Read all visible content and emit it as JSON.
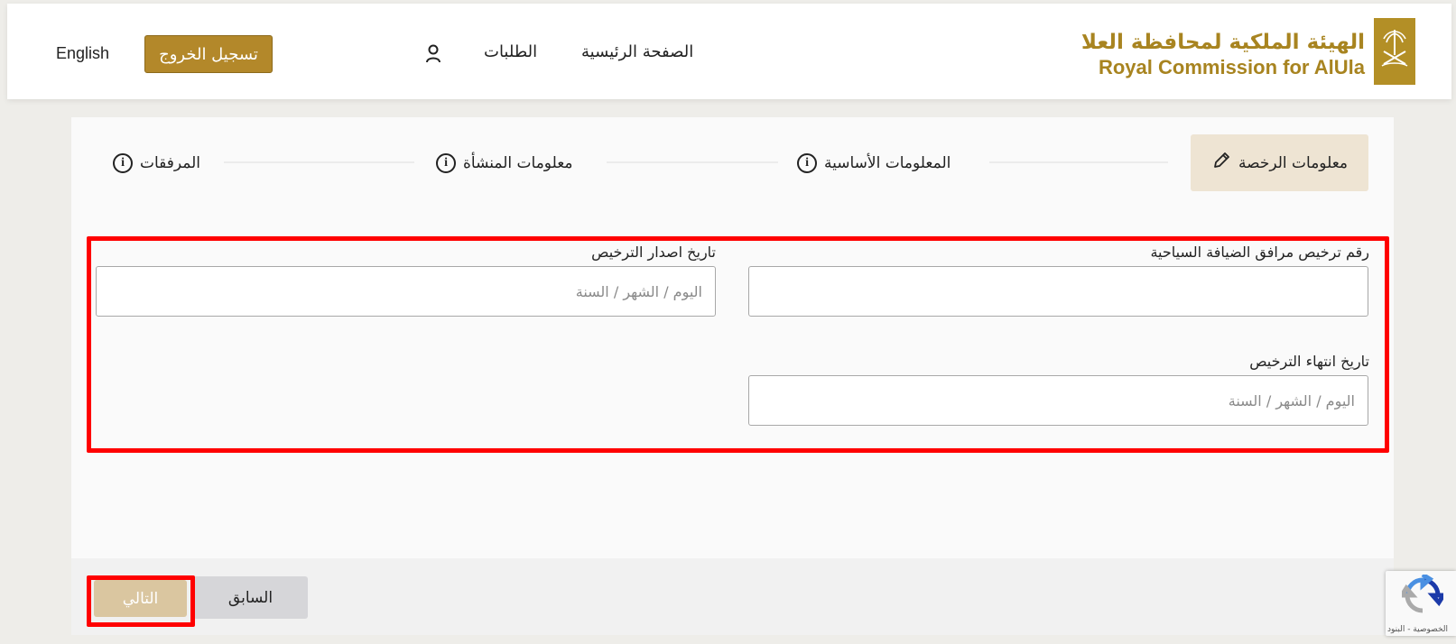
{
  "header": {
    "logo_ar": "الهيئة الملكية لمحافظة العلا",
    "logo_en": "Royal Commission for AlUla",
    "nav_home": "الصفحة الرئيسية",
    "nav_requests": "الطلبات",
    "user_name": "",
    "logout_label": "تسجيل الخروج",
    "language_label": "English"
  },
  "steps": [
    {
      "label": "معلومات الرخصة",
      "icon": "pencil-icon",
      "active": true
    },
    {
      "label": "المعلومات الأساسية",
      "icon": "info-icon",
      "active": false
    },
    {
      "label": "معلومات المنشأة",
      "icon": "info-icon",
      "active": false
    },
    {
      "label": "المرفقات",
      "icon": "info-icon",
      "active": false
    }
  ],
  "form": {
    "license_number_label": "رقم ترخيص مرافق الضيافة السياحية",
    "license_number_value": "",
    "issue_date_label": "تاريخ اصدار الترخيص",
    "issue_date_placeholder": "اليوم / الشهر / السنة",
    "expiry_date_label": "تاريخ انتهاء الترخيص",
    "expiry_date_placeholder": "اليوم / الشهر / السنة"
  },
  "buttons": {
    "previous": "السابق",
    "next": "التالي"
  },
  "recaptcha": {
    "text": "الخصوصية - البنود"
  },
  "colors": {
    "brand_gold": "#b3882a",
    "active_step_bg": "#eee4d3",
    "highlight_red": "#ff0000"
  }
}
